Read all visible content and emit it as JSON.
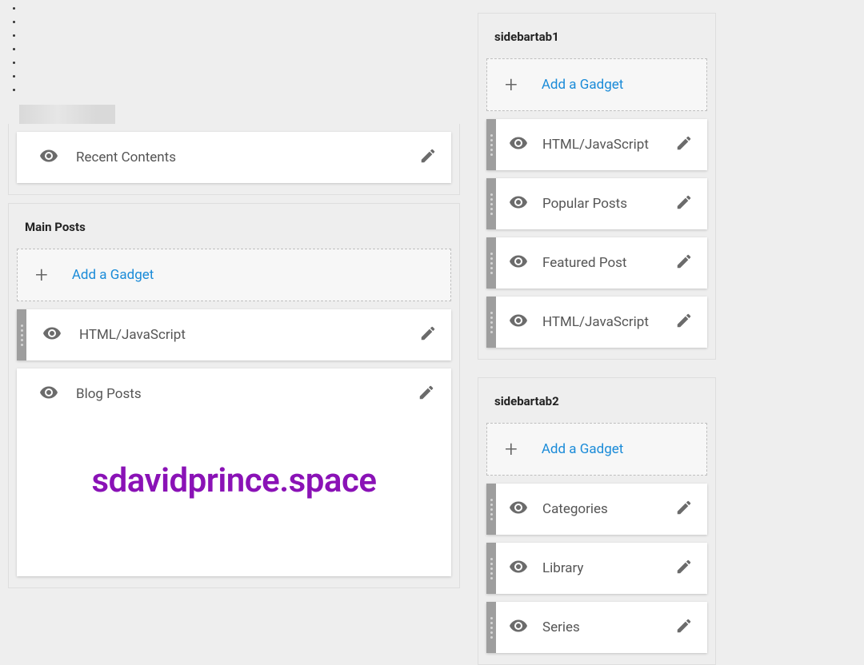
{
  "watermark": "sdavidprince.space",
  "add_gadget_label": "Add a Gadget",
  "columns": {
    "left": {
      "recent_section_widget": "Recent Contents",
      "main_posts": {
        "title": "Main Posts",
        "widgets": [
          {
            "title": "HTML/JavaScript",
            "has_handle": true
          },
          {
            "title": "Blog Posts",
            "has_handle": false,
            "is_blog_posts": true
          }
        ]
      }
    },
    "right": {
      "sidebartab1": {
        "title": "sidebartab1",
        "widgets": [
          {
            "title": "HTML/JavaScript"
          },
          {
            "title": "Popular Posts"
          },
          {
            "title": "Featured Post"
          },
          {
            "title": "HTML/JavaScript"
          }
        ]
      },
      "sidebartab2": {
        "title": "sidebartab2",
        "widgets": [
          {
            "title": "Categories"
          },
          {
            "title": "Library"
          },
          {
            "title": "Series"
          }
        ]
      }
    }
  }
}
